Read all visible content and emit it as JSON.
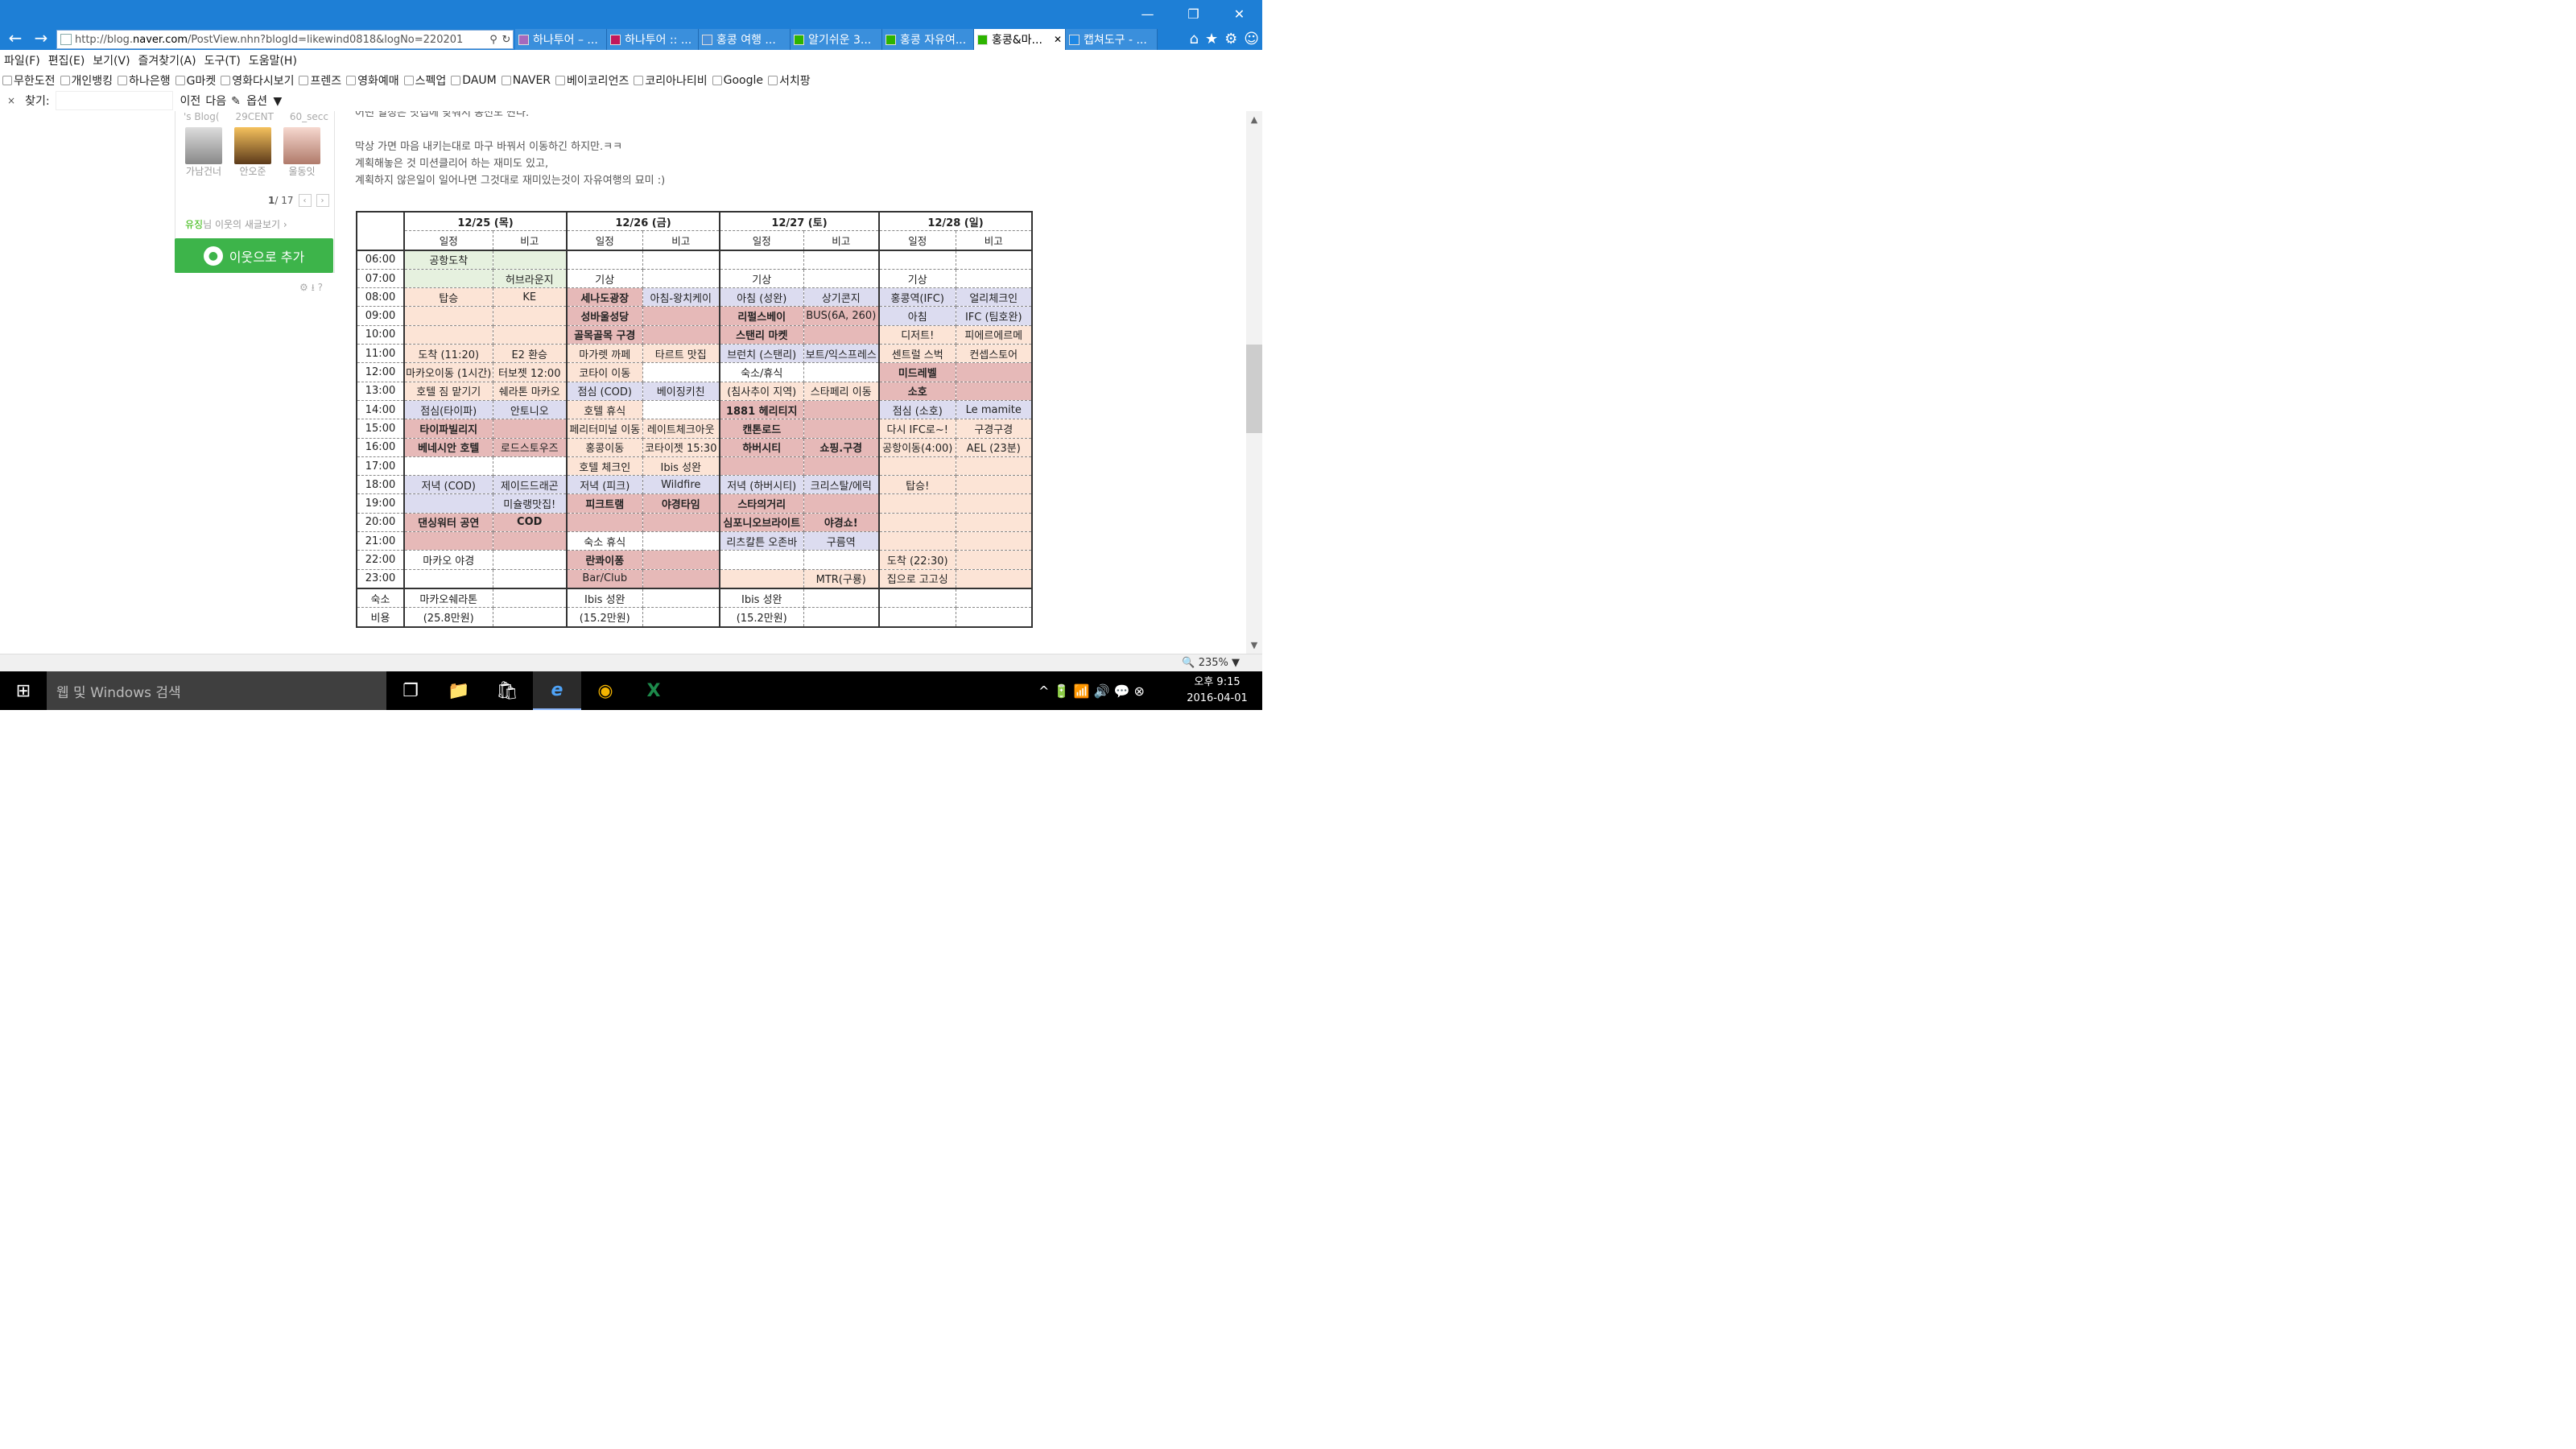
{
  "window": {
    "minimize": "—",
    "restore": "❐",
    "close": "✕"
  },
  "nav": {
    "back": "←",
    "forward": "→"
  },
  "address": {
    "prefix": "http://blog.",
    "domain": "naver.com",
    "suffix": "/PostView.nhn?blogId=likewind0818&logNo=220201",
    "search_icon": "⚲",
    "refresh_icon": "↻"
  },
  "tabs": [
    {
      "label": "하나투어 – ...",
      "icon_color": "#a569bd"
    },
    {
      "label": "하나투어 :: ...",
      "icon_color": "#c2185b"
    },
    {
      "label": "홍콩 여행 ...",
      "icon_color": "#4a90d9"
    },
    {
      "label": "알기쉬운 3...",
      "icon_color": "#2db400"
    },
    {
      "label": "홍콩 자유여...",
      "icon_color": "#2db400"
    },
    {
      "label": "홍콩&마...",
      "icon_color": "#2db400",
      "active": true,
      "close": "✕"
    },
    {
      "label": "캡쳐도구 - ...",
      "icon_color": "#1e88e5"
    }
  ],
  "right_icons": {
    "home": "⌂",
    "star": "★",
    "gear": "⚙",
    "smile": "☺"
  },
  "menu": [
    "파일(F)",
    "편집(E)",
    "보기(V)",
    "즐겨찾기(A)",
    "도구(T)",
    "도움말(H)"
  ],
  "favorites": [
    "무한도전",
    "개인뱅킹",
    "하나은행",
    "G마켓",
    "영화다시보기",
    "프렌즈",
    "영화예매",
    "스펙업",
    "DAUM",
    "NAVER",
    "베이코리언즈",
    "코리아나티비",
    "Google",
    "서치팡"
  ],
  "find": {
    "close": "×",
    "label": "찾기:",
    "prev": "이전",
    "next": "다음",
    "options": "옵션"
  },
  "sidebar": {
    "neighbors_top": [
      "'s Blog(",
      "29CENT",
      "60_secc"
    ],
    "avatars": [
      {
        "name": "가남건너"
      },
      {
        "name": "안오준"
      },
      {
        "name": "울동잇"
      }
    ],
    "page_current": "1",
    "page_total": "/ 17",
    "recent_user": "유징",
    "recent_text": "님 이웃의 새글보기 ›",
    "add_button": "이웃으로 추가",
    "tools": "⚙ ⭳ ?"
  },
  "post_lines": [
    "어떤 일정은 맛집에 맞춰서 동선도 짠다.",
    "",
    "막상 가면 마음 내키는대로 마구 바꿔서 이동하긴 하지만.ㅋㅋ",
    "계획해놓은 것 미션클리어 하는 재미도 있고,",
    "계획하지 않은일이 일어나면 그것대로 재미있는것이 자유여행의 묘미 :)"
  ],
  "schedule": {
    "days": [
      "12/25 (목)",
      "12/26 (금)",
      "12/27 (토)",
      "12/28 (일)"
    ],
    "sub_headers": [
      "일정",
      "비고"
    ],
    "rows": [
      {
        "time": "06:00",
        "cells": [
          [
            "공항도착",
            "G"
          ],
          [
            "",
            "G"
          ],
          [
            "",
            ""
          ],
          [
            "",
            ""
          ],
          [
            "",
            ""
          ],
          [
            "",
            ""
          ],
          [
            "",
            ""
          ],
          [
            "",
            ""
          ]
        ]
      },
      {
        "time": "07:00",
        "cells": [
          [
            "",
            "G"
          ],
          [
            "허브라운지",
            "G"
          ],
          [
            "기상",
            ""
          ],
          [
            "",
            ""
          ],
          [
            "기상",
            ""
          ],
          [
            "",
            ""
          ],
          [
            "기상",
            ""
          ],
          [
            "",
            ""
          ]
        ]
      },
      {
        "time": "08:00",
        "cells": [
          [
            "탑승",
            "O"
          ],
          [
            "KE",
            "O"
          ],
          [
            "세나도광장",
            "RB"
          ],
          [
            "아침-왕치케이",
            "L"
          ],
          [
            "아침 (성완)",
            "L"
          ],
          [
            "상기콘지",
            "L"
          ],
          [
            "홍콩역(IFC)",
            "L"
          ],
          [
            "얼리체크인",
            "L"
          ]
        ]
      },
      {
        "time": "09:00",
        "cells": [
          [
            "",
            "O"
          ],
          [
            "",
            "O"
          ],
          [
            "성바울성당",
            "RB"
          ],
          [
            "",
            "R"
          ],
          [
            "리펄스베이",
            "RB"
          ],
          [
            "BUS(6A, 260)",
            "R"
          ],
          [
            "아침",
            "L"
          ],
          [
            "IFC (팀호완)",
            "L"
          ]
        ]
      },
      {
        "time": "10:00",
        "cells": [
          [
            "",
            "O"
          ],
          [
            "",
            "O"
          ],
          [
            "골목골목 구경",
            "RB"
          ],
          [
            "",
            "R"
          ],
          [
            "스탠리 마켓",
            "RB"
          ],
          [
            "",
            "R"
          ],
          [
            "디저트!",
            "O"
          ],
          [
            "피에르에르메",
            "O"
          ]
        ]
      },
      {
        "time": "11:00",
        "cells": [
          [
            "도착 (11:20)",
            "O"
          ],
          [
            "E2 환승",
            "O"
          ],
          [
            "마가렛 까페",
            "O"
          ],
          [
            "타르트 맛집",
            "O"
          ],
          [
            "브런치 (스탠리)",
            "L"
          ],
          [
            "보트/익스프레스",
            "L"
          ],
          [
            "센트럴 스벅",
            "O"
          ],
          [
            "컨셉스토어",
            "O"
          ]
        ]
      },
      {
        "time": "12:00",
        "cells": [
          [
            "마카오이동 (1시간)",
            "O"
          ],
          [
            "터보젯 12:00",
            "O"
          ],
          [
            "코타이 이동",
            "O"
          ],
          [
            "",
            ""
          ],
          [
            "숙소/휴식",
            ""
          ],
          [
            "",
            ""
          ],
          [
            "미드레벨",
            "RB"
          ],
          [
            "",
            "R"
          ]
        ]
      },
      {
        "time": "13:00",
        "cells": [
          [
            "호텔 짐 맡기기",
            "O"
          ],
          [
            "쉐라톤 마카오",
            "O"
          ],
          [
            "점심 (COD)",
            "L"
          ],
          [
            "베이징키친",
            "L"
          ],
          [
            "(침사추이 지역)",
            "O"
          ],
          [
            "스타페리 이동",
            "O"
          ],
          [
            "소호",
            "RB"
          ],
          [
            "",
            "R"
          ]
        ]
      },
      {
        "time": "14:00",
        "cells": [
          [
            "점심(타이파)",
            "L"
          ],
          [
            "안토니오",
            "L"
          ],
          [
            "호텔 휴식",
            "O"
          ],
          [
            "",
            ""
          ],
          [
            "1881 헤리티지",
            "RB"
          ],
          [
            "",
            "R"
          ],
          [
            "점심 (소호)",
            "L"
          ],
          [
            "Le mamite",
            "L"
          ]
        ]
      },
      {
        "time": "15:00",
        "cells": [
          [
            "타이파빌리지",
            "RB"
          ],
          [
            "",
            "R"
          ],
          [
            "페리터미널 이동",
            "O"
          ],
          [
            "레이트체크아웃",
            "O"
          ],
          [
            "캔톤로드",
            "RB"
          ],
          [
            "",
            "R"
          ],
          [
            "다시 IFC로~!",
            "O"
          ],
          [
            "구경구경",
            "O"
          ]
        ]
      },
      {
        "time": "16:00",
        "cells": [
          [
            "베네시안 호텔",
            "RB"
          ],
          [
            "로드스토우즈",
            "R"
          ],
          [
            "홍콩이동",
            "O"
          ],
          [
            "코타이젯 15:30",
            "O"
          ],
          [
            "하버시티",
            "RB"
          ],
          [
            "쇼핑.구경",
            "RB"
          ],
          [
            "공항이동(4:00)",
            "O"
          ],
          [
            "AEL (23분)",
            "O"
          ]
        ]
      },
      {
        "time": "17:00",
        "cells": [
          [
            "",
            ""
          ],
          [
            "",
            ""
          ],
          [
            "호텔 체크인",
            "O"
          ],
          [
            "Ibis 성완",
            "O"
          ],
          [
            "",
            "R"
          ],
          [
            "",
            "R"
          ],
          [
            "",
            "O"
          ],
          [
            "",
            "O"
          ]
        ]
      },
      {
        "time": "18:00",
        "cells": [
          [
            "저녁 (COD)",
            "L"
          ],
          [
            "제이드드래곤",
            "L"
          ],
          [
            "저녁 (피크)",
            "L"
          ],
          [
            "Wildfire",
            "L"
          ],
          [
            "저녁 (하버시티)",
            "L"
          ],
          [
            "크리스탈/에릭",
            "L"
          ],
          [
            "탑승!",
            "O"
          ],
          [
            "",
            "O"
          ]
        ]
      },
      {
        "time": "19:00",
        "cells": [
          [
            "",
            "L"
          ],
          [
            "미슐랭맛집!",
            "L"
          ],
          [
            "피크트램",
            "RB"
          ],
          [
            "야경타임",
            "RB"
          ],
          [
            "스타의거리",
            "RB"
          ],
          [
            "",
            "R"
          ],
          [
            "",
            "O"
          ],
          [
            "",
            "O"
          ]
        ]
      },
      {
        "time": "20:00",
        "cells": [
          [
            "댄싱워터 공연",
            "RB"
          ],
          [
            "COD",
            "RB"
          ],
          [
            "",
            "R"
          ],
          [
            "",
            "R"
          ],
          [
            "심포니오브라이트",
            "RB"
          ],
          [
            "야경쇼!",
            "RB"
          ],
          [
            "",
            "O"
          ],
          [
            "",
            "O"
          ]
        ]
      },
      {
        "time": "21:00",
        "cells": [
          [
            "",
            "R"
          ],
          [
            "",
            "R"
          ],
          [
            "숙소 휴식",
            ""
          ],
          [
            "",
            ""
          ],
          [
            "리츠칼튼 오존바",
            "L"
          ],
          [
            "구름역",
            "L"
          ],
          [
            "",
            "O"
          ],
          [
            "",
            "O"
          ]
        ]
      },
      {
        "time": "22:00",
        "cells": [
          [
            "마카오 야경",
            ""
          ],
          [
            "",
            ""
          ],
          [
            "란콰이퐁",
            "RB"
          ],
          [
            "",
            "R"
          ],
          [
            "",
            ""
          ],
          [
            "",
            ""
          ],
          [
            "도착 (22:30)",
            "O"
          ],
          [
            "",
            "O"
          ]
        ]
      },
      {
        "time": "23:00",
        "cells": [
          [
            "",
            ""
          ],
          [
            "",
            ""
          ],
          [
            "Bar/Club",
            "R"
          ],
          [
            "",
            "R"
          ],
          [
            "",
            "O"
          ],
          [
            "MTR(구룡)",
            "O"
          ],
          [
            "집으로 고고싱",
            "O"
          ],
          [
            "",
            "O"
          ]
        ]
      }
    ],
    "footer": [
      {
        "label": "숙소",
        "cells": [
          "마카오쉐라톤",
          "",
          "Ibis 성완",
          "",
          "Ibis 성완",
          "",
          "",
          ""
        ]
      },
      {
        "label": "비용",
        "cells": [
          "(25.8만원)",
          "",
          "(15.2만원)",
          "",
          "(15.2만원)",
          "",
          "",
          ""
        ]
      }
    ]
  },
  "status": {
    "zoom": "235%"
  },
  "taskbar": {
    "start": "⊞",
    "search_placeholder": "웹 및 Windows 검색",
    "task_view": "❐",
    "explorer": "📁",
    "store": "🛍",
    "ie": "e",
    "chrome": "◉",
    "excel": "X",
    "tray": "^  🔋  📶  🔊  💬  ⊗",
    "time": "오후 9:15",
    "date": "2016-04-01"
  }
}
